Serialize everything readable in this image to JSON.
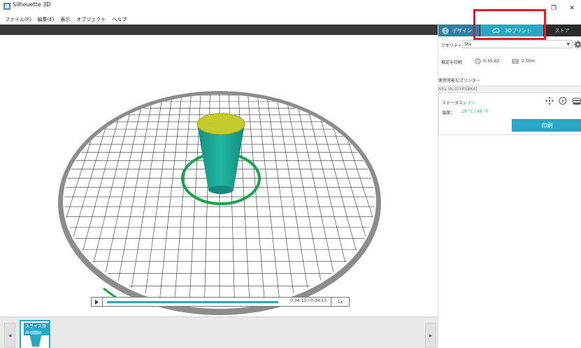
{
  "window": {
    "title": "Silhouette 3D",
    "controls": {
      "restore": "❐",
      "close": "✕"
    }
  },
  "menu": [
    "ファイル(F)",
    "編集(E)",
    "表示",
    "オブジェクト",
    "ヘルプ"
  ],
  "panel": {
    "tabs": {
      "design": "デザイン",
      "print3d": "3Dプリント",
      "store": "ストア"
    },
    "quality": {
      "label": "クオリティ",
      "value": "Sta"
    },
    "estimate": {
      "label": "推定を印刷",
      "time": "0:35:02",
      "length": "0.50m"
    },
    "printers": {
      "header": "使用可能なプリンター",
      "name": "Alta (ALt05RSBKA)",
      "status_label": "ステータス:",
      "status_value": "レディ",
      "temp_label": "温度：",
      "temp_value": "19 °C / 66 °F",
      "print_button": "印刷"
    }
  },
  "playback": {
    "time": "0:34:13 / 0:34:13",
    "speed": "1x",
    "progress": 1.0
  },
  "thumbnails": [
    {
      "label": "スライス済み"
    }
  ],
  "colors": {
    "accent": "#2aa6c6",
    "highlight": "#e21d26",
    "model": "#1fb5a0",
    "model_top": "#c8cf2e",
    "ring": "#15a64b"
  },
  "icons": {
    "design_tab": "globe-icon",
    "print_tab": "cloud-printer-icon",
    "settings": "gear-icon",
    "move": "move-icon",
    "home": "home-icon",
    "bed": "bed-icon"
  }
}
